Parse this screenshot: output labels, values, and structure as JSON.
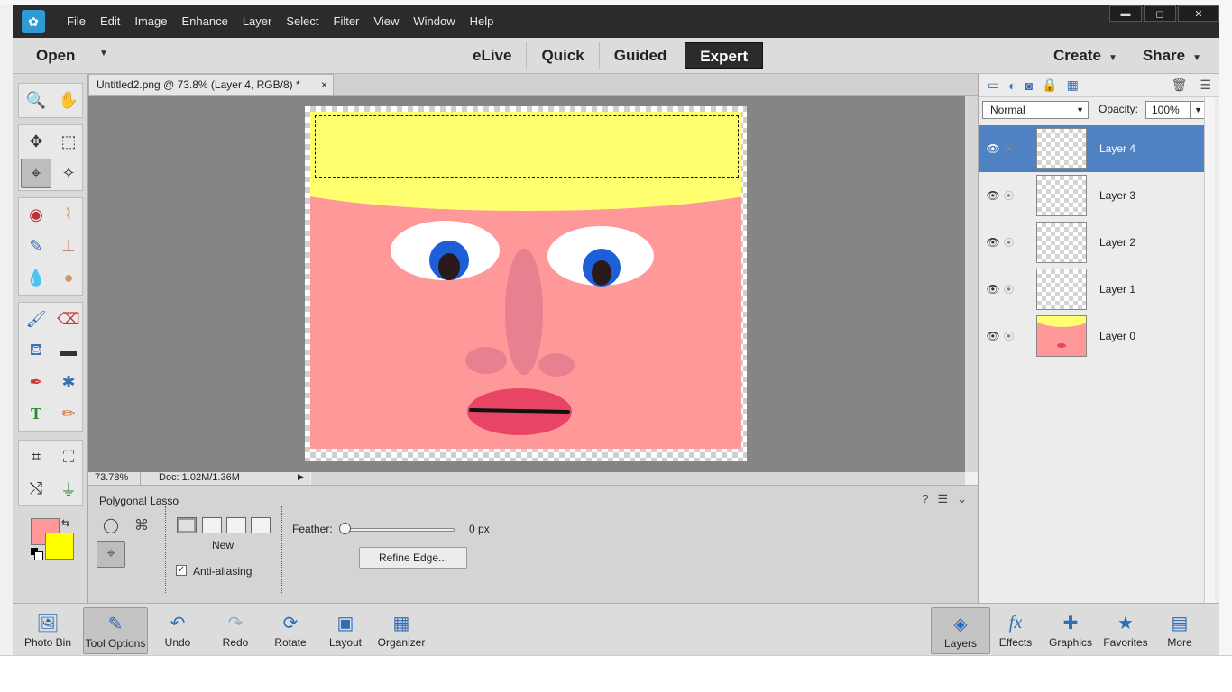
{
  "menu": {
    "items": [
      "File",
      "Edit",
      "Image",
      "Enhance",
      "Layer",
      "Select",
      "Filter",
      "View",
      "Window",
      "Help"
    ]
  },
  "window_controls": {
    "minimize": "▬",
    "maximize": "◻",
    "close": "✕"
  },
  "modebar": {
    "open": "Open",
    "modes": [
      "eLive",
      "Quick",
      "Guided",
      "Expert"
    ],
    "active_mode": "Expert",
    "create": "Create",
    "share": "Share"
  },
  "document": {
    "tab_title": "Untitled2.png @ 73.8% (Layer 4, RGB/8) *",
    "tab_close": "×",
    "zoom": "73.78%",
    "doc_size": "Doc: 1.02M/1.36M"
  },
  "tool_options": {
    "title": "Polygonal Lasso",
    "selection_mode_label": "New",
    "anti_aliasing_label": "Anti-aliasing",
    "anti_aliasing_checked": true,
    "feather_label": "Feather:",
    "feather_value": "0 px",
    "feather_fraction": 0,
    "refine_edge": "Refine Edge..."
  },
  "colors": {
    "foreground": "#ff9999",
    "background": "#ffff00"
  },
  "layers_panel": {
    "blend_mode": "Normal",
    "opacity_label": "Opacity:",
    "opacity_value": "100%",
    "layers": [
      {
        "name": "Layer 4",
        "active": true
      },
      {
        "name": "Layer 3",
        "active": false
      },
      {
        "name": "Layer 2",
        "active": false
      },
      {
        "name": "Layer 1",
        "active": false
      },
      {
        "name": "Layer 0",
        "active": false
      }
    ]
  },
  "bottombar": {
    "left": [
      "Photo Bin",
      "Tool Options",
      "Undo",
      "Redo",
      "Rotate",
      "Layout",
      "Organizer"
    ],
    "right": [
      "Layers",
      "Effects",
      "Graphics",
      "Favorites",
      "More"
    ]
  }
}
